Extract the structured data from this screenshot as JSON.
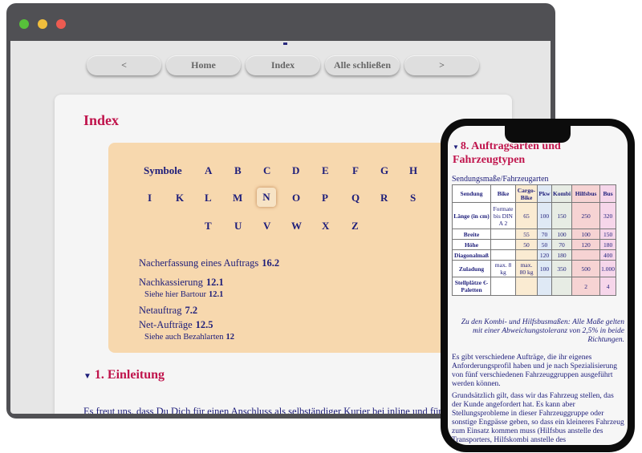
{
  "browser": {
    "traffic_lights": [
      "#57c13a",
      "#f1be3c",
      "#ec5b51"
    ],
    "nav": [
      "<",
      "Home",
      "Index",
      "Alle schließen",
      ">"
    ]
  },
  "index_page": {
    "title": "Index",
    "letters_row1": [
      "Symbole",
      "A",
      "B",
      "C",
      "D",
      "E",
      "F",
      "G",
      "H"
    ],
    "letters_row2": [
      "I",
      "K",
      "L",
      "M",
      "N",
      "O",
      "P",
      "Q",
      "R",
      "S"
    ],
    "letters_row3": [
      "T",
      "U",
      "V",
      "W",
      "X",
      "Z"
    ],
    "selected_letter": "N",
    "entries": [
      {
        "label": "Nacherfassung eines Auftrags",
        "ref": "16.2"
      },
      {
        "label": "Nachkassierung",
        "ref": "12.1"
      },
      {
        "label": "Siehe hier Bartour",
        "ref": "12.1"
      },
      {
        "label": "Netauftrag",
        "ref": "7.2"
      },
      {
        "label": "Net-Aufträge",
        "ref": "12.5"
      },
      {
        "label": "Siehe auch Bezahlarten",
        "ref": "12"
      }
    ],
    "section_title": "1. Einleitung",
    "paragraph": "Es freut uns, dass Du Dich für einen Anschluss als selbständiger Kurier bei inline und für eine Mitgliedschaft im iKV (inline Kurier Verein) interessierst."
  },
  "phone_page": {
    "title": "8. Auftragsarten und Fahrzeugtypen",
    "caption": "Sendungsmaße/Fahrzeugarten",
    "table": {
      "headers": [
        "Sendung",
        "Bike",
        "Cargo-Bike",
        "Pkw",
        "Kombi",
        "Hilfsbus",
        "Bus"
      ],
      "rows": [
        [
          "Länge (in cm)",
          "Formate bis DIN A 2",
          "65",
          "100",
          "150",
          "250",
          "320"
        ],
        [
          "Breite",
          "",
          "55",
          "70",
          "100",
          "100",
          "150"
        ],
        [
          "Höhe",
          "",
          "50",
          "50",
          "70",
          "120",
          "180"
        ],
        [
          "Diagonalmaß",
          "",
          "",
          "120",
          "180",
          "",
          "400"
        ],
        [
          "Zuladung",
          "max. 8 kg",
          "max. 80 kg",
          "100",
          "350",
          "500",
          "1.000"
        ],
        [
          "Stellplätze €-Paletten",
          "",
          "",
          "",
          "",
          "2",
          "4"
        ]
      ]
    },
    "note": "Zu den Kombi- und Hilfsbusmaßen: Alle Maße gelten mit einer Abweichungstoleranz von 2,5% in beide Richtungen.",
    "para1": "Es gibt verschiedene Aufträge, die ihr eigenes Anforderungsprofil haben und je nach Spezialisierung von fünf verschiedenen Fahrzeuggruppen ausgeführt werden können.",
    "para2": "Grundsätzlich gilt, dass wir das Fahrzeug stellen, das der Kunde angefordert hat. Es kann aber Stellungsprobleme in dieser Fahrzeuggruppe oder sonstige Engpässe geben, so dass ein kleineres Fahrzeug zum Einsatz kommen muss (Hilfsbus anstelle des Transporters, Hilfskombi anstelle des"
  }
}
